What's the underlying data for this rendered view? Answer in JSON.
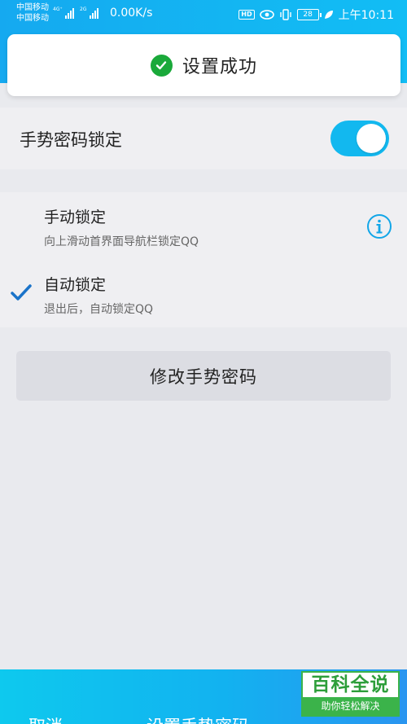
{
  "status_bar": {
    "carrier_1": "中国移动",
    "carrier_2": "中国移动",
    "net_1": "4G⁺",
    "net_2": "2G",
    "speed": "0.00K/s",
    "hd": "HD",
    "battery": "28",
    "time": "上午10:11"
  },
  "toast": {
    "text": "设置成功",
    "icon": "check-circle-icon"
  },
  "gesture_lock": {
    "label": "手势密码锁定",
    "enabled": true
  },
  "options": [
    {
      "title": "手动锁定",
      "desc": "向上滑动首界面导航栏锁定QQ",
      "selected": false
    },
    {
      "title": "自动锁定",
      "desc": "退出后，自动锁定QQ",
      "selected": true
    }
  ],
  "change_button": "修改手势密码",
  "bottom_bar": {
    "cancel": "取消",
    "set_gesture": "设置手势密码"
  },
  "watermark": {
    "big": "百科全说",
    "small": "助你轻松解决"
  },
  "colors": {
    "accent": "#12b8ef",
    "success": "#1aa93a"
  }
}
